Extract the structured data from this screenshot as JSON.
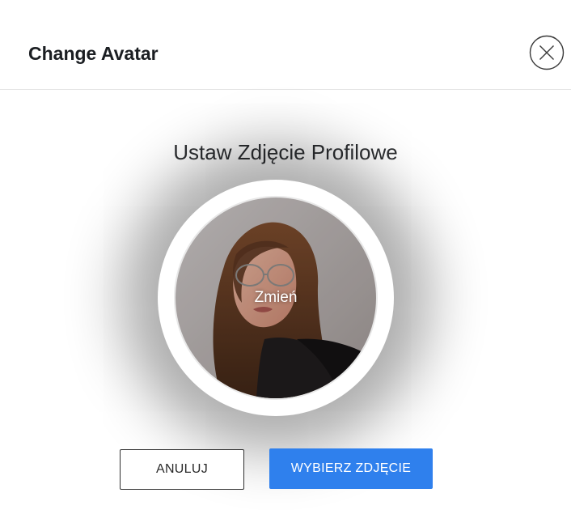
{
  "modal": {
    "title": "Change Avatar",
    "close_icon": "close-circle-icon"
  },
  "content": {
    "subtitle": "Ustaw Zdjęcie Profilowe",
    "avatar_overlay_label": "Zmień"
  },
  "actions": {
    "cancel_label": "ANULUJ",
    "choose_label": "WYBIERZ ZDJĘCIE"
  },
  "colors": {
    "primary": "#2f80ed",
    "title_text": "#1b1e22",
    "border": "#e4e4e4"
  }
}
